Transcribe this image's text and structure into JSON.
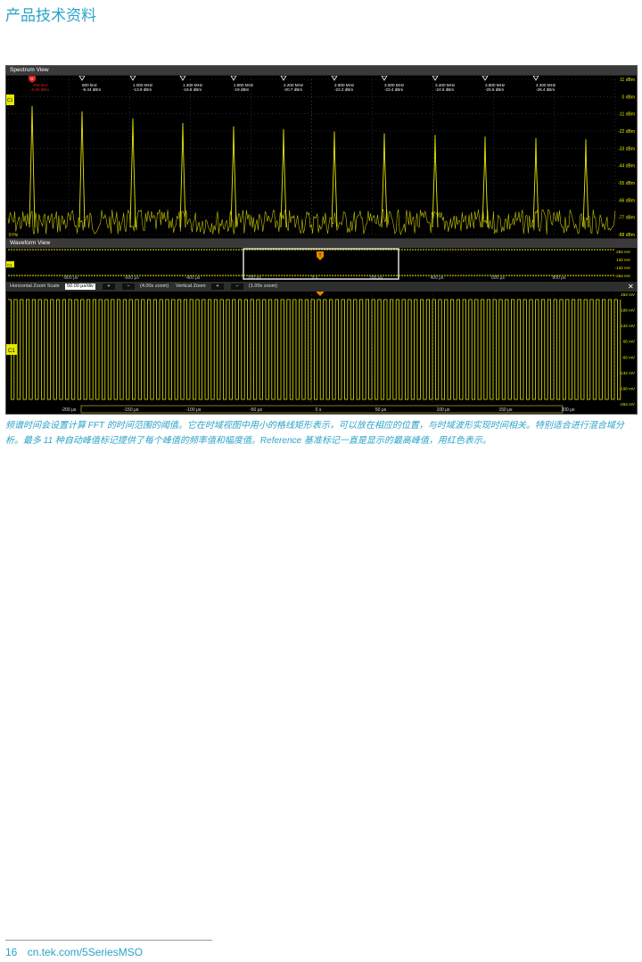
{
  "header": {
    "title": "产品技术资料"
  },
  "spectrum": {
    "title": "Spectrum View",
    "ref_marker": {
      "label": "R",
      "freq": "200 kHz",
      "amp": "-6.00 dBm"
    },
    "markers": [
      {
        "freq": "600 kHz",
        "amp": "-9.44 dBm"
      },
      {
        "freq": "1.000 MHz",
        "amp": "-13.9 dBm"
      },
      {
        "freq": "1.400 MHz",
        "amp": "-16.8 dBm"
      },
      {
        "freq": "1.800 MHz",
        "amp": "-19 dBm"
      },
      {
        "freq": "2.200 MHz",
        "amp": "-20.7 dBm"
      },
      {
        "freq": "2.600 MHz",
        "amp": "-22.2 dBm"
      },
      {
        "freq": "3.000 MHz",
        "amp": "-23.4 dBm"
      },
      {
        "freq": "3.400 MHz",
        "amp": "-24.5 dBm"
      },
      {
        "freq": "3.800 MHz",
        "amp": "-25.5 dBm"
      },
      {
        "freq": "4.200 MHz",
        "amp": "-26.4 dBm"
      }
    ],
    "y_ticks": [
      "11 dBm",
      "0 dBm",
      "-11 dBm",
      "-22 dBm",
      "-33 dBm",
      "-44 dBm",
      "-55 dBm",
      "-66 dBm",
      "-77 dBm",
      "-88 dBm"
    ],
    "x_start": "0 Hz",
    "channel_label": "C1"
  },
  "waveform": {
    "title": "Waveform View",
    "overview_ticks": [
      "-800 μs",
      "-600 μs",
      "-400 μs",
      "-200 μs",
      "0 s",
      "200 μs",
      "400 μs",
      "600 μs",
      "800 μs"
    ],
    "overview_y_ticks": [
      "264 mV",
      "132 mV",
      "-132 mV",
      "-264 mV"
    ],
    "zoom": {
      "h_label": "Horizontal Zoom Scale",
      "h_value": "50.00 μs/div",
      "h_factor": "(4.00x zoom)",
      "v_label": "Vertical Zoom",
      "v_factor": "(1.00x zoom)",
      "plus": "+",
      "minus": "−",
      "close": "✕"
    },
    "y_ticks": [
      "264 mV",
      "198 mV",
      "132 mV",
      "66 mV",
      "-66 mV",
      "-132 mV",
      "-198 mV",
      "-264 mV"
    ],
    "x_ticks": [
      "-200 μs",
      "-150 μs",
      "-100 μs",
      "-50 μs",
      "0 s",
      "50 μs",
      "100 μs",
      "150 μs",
      "200 μs"
    ],
    "channel_label": "C1",
    "trigger_label": "T"
  },
  "caption": "频谱时间会设置计算 FFT 的时间范围的阈值。它在时域视图中用小的格线矩形表示，可以放在相应的位置，与时域波形实现时间相关。特别适合进行混合域分析。最多 11 种自动峰值标记提供了每个峰值的频率值和幅度值。Reference 基准标记一直是显示的最高峰值，用红色表示。",
  "footer": {
    "page": "16",
    "url": "cn.tek.com/5SeriesMSO"
  },
  "colors": {
    "accent": "#2aa3c8",
    "trace": "#e8e800",
    "ref_marker": "#e02020"
  }
}
